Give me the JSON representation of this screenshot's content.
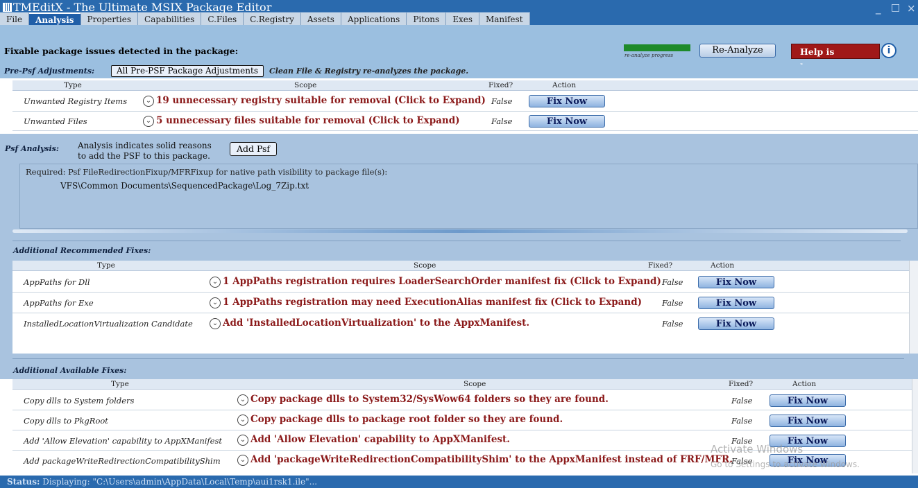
{
  "window": {
    "title": "TMEditX - The Ultimate MSIX Package Editor",
    "minimize": "_",
    "maximize": "□",
    "close": "×"
  },
  "tabs": [
    "File",
    "Analysis",
    "Properties",
    "Capabilities",
    "C.Files",
    "C.Registry",
    "Assets",
    "Applications",
    "Pitons",
    "Exes",
    "Manifest"
  ],
  "active_tab": "Analysis",
  "header": {
    "text": "Fixable package issues detected in the package:",
    "progress_label": "re-analyze progress",
    "reanalyze_label": "Re-Analyze",
    "help_label": "Help is here==>",
    "info": "i"
  },
  "prepsf": {
    "label": "Pre-Psf Adjustments:",
    "button": "All Pre-PSF Package Adjustments",
    "note": "Clean File & Registry re-analyzes the package."
  },
  "cols": {
    "type": "Type",
    "scope": "Scope",
    "fixed": "Fixed?",
    "action": "Action"
  },
  "prepsf_rows": [
    {
      "type": "Unwanted Registry Items",
      "scope": "19 unnecessary registry suitable for removal (Click to Expand)",
      "fixed": "False",
      "action": "Fix Now"
    },
    {
      "type": "Unwanted Files",
      "scope": "5 unnecessary files suitable for removal (Click to Expand)",
      "fixed": "False",
      "action": "Fix Now"
    }
  ],
  "psf": {
    "label": "Psf Analysis:",
    "reason1": "Analysis indicates solid reasons",
    "reason2": "to add the PSF to this package.",
    "button": "Add Psf",
    "required": "Required: Psf FileRedirectionFixup/MFRFixup for native path visibility to package file(s):",
    "path": "VFS\\Common Documents\\SequencedPackage\\Log_7Zip.txt"
  },
  "recommended": {
    "label": "Additional Recommended Fixes:",
    "rows": [
      {
        "type": "AppPaths for Dll",
        "scope": "1 AppPaths registration requires LoaderSearchOrder manifest fix (Click to Expand)",
        "fixed": "False",
        "action": "Fix Now"
      },
      {
        "type": "AppPaths for Exe",
        "scope": "1 AppPaths registration may need ExecutionAlias manifest fix (Click to Expand)",
        "fixed": "False",
        "action": "Fix Now"
      },
      {
        "type": "InstalledLocationVirtualization Candidate",
        "scope": "Add 'InstalledLocationVirtualization' to the AppxManifest.",
        "fixed": "False",
        "action": "Fix Now"
      }
    ]
  },
  "available": {
    "label": "Additional Available Fixes:",
    "rows": [
      {
        "type": "Copy dlls to System folders",
        "scope": "Copy package dlls to System32/SysWow64 folders so they are found.",
        "fixed": "False",
        "action": "Fix Now"
      },
      {
        "type": "Copy dlls to PkgRoot",
        "scope": "Copy package dlls to package root folder so they are found.",
        "fixed": "False",
        "action": "Fix Now"
      },
      {
        "type": "Add 'Allow Elevation' capability to AppXManifest",
        "scope": "Add 'Allow Elevation' capability to AppXManifest.",
        "fixed": "False",
        "action": "Fix Now"
      },
      {
        "type": "Add packageWriteRedirectionCompatibilityShim",
        "scope": "Add 'packageWriteRedirectionCompatibilityShim' to the AppxManifest instead of FRF/MFR.",
        "fixed": "False",
        "action": "Fix Now"
      }
    ]
  },
  "status": {
    "label": "Status:",
    "text": "Displaying: \"C:\\Users\\admin\\AppData\\Local\\Temp\\aui1rsk1.ile\"..."
  },
  "watermark": {
    "line1": "Activate Windows",
    "line2": "Go to Settings to activate Windows."
  }
}
